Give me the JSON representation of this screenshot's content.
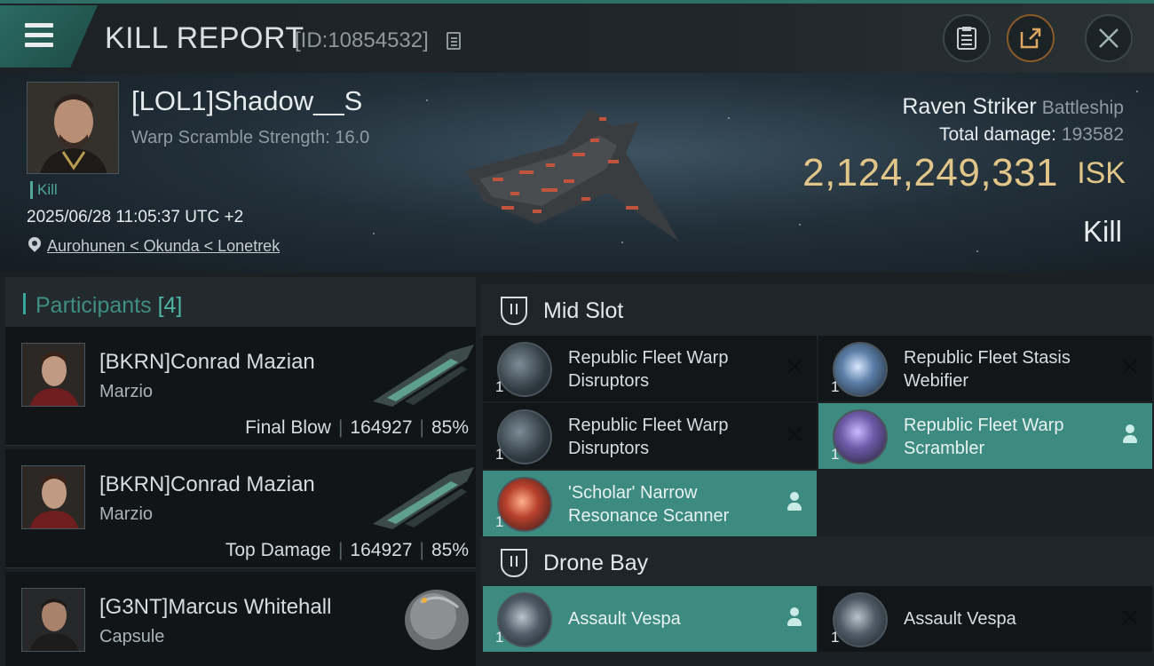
{
  "header": {
    "title": "KILL REPORT",
    "report_id": "[ID:10854532]"
  },
  "victim": {
    "name": "[LOL1]Shadow__S",
    "warp_strength": "Warp Scramble Strength: 16.0",
    "kill_tag": "Kill",
    "timestamp": "2025/06/28 11:05:37 UTC +2",
    "location": "Aurohunen < Okunda < Lonetrek",
    "ship_name": "Raven Striker",
    "ship_class": "Battleship",
    "total_damage_label": "Total damage:",
    "total_damage": "193582",
    "isk_value": "2,124,249,331",
    "isk_unit": "ISK",
    "result": "Kill"
  },
  "participants": {
    "label": "Participants",
    "count": "[4]",
    "items": [
      {
        "name": "[BKRN]Conrad Mazian",
        "ship": "Marzio",
        "role": "Final Blow",
        "damage": "164927",
        "percent": "85%"
      },
      {
        "name": "[BKRN]Conrad Mazian",
        "ship": "Marzio",
        "role": "Top Damage",
        "damage": "164927",
        "percent": "85%"
      },
      {
        "name": "[G3NT]Marcus Whitehall",
        "ship": "Capsule"
      }
    ]
  },
  "mid_slot": {
    "label": "Mid Slot",
    "items": [
      {
        "name": "Republic Fleet Warp Disruptors",
        "qty": "1",
        "status": "destroyed"
      },
      {
        "name": "Republic Fleet Stasis Webifier",
        "qty": "1",
        "status": "destroyed"
      },
      {
        "name": "Republic Fleet Warp Disruptors",
        "qty": "1",
        "status": "destroyed"
      },
      {
        "name": "Republic Fleet Warp Scrambler",
        "qty": "1",
        "status": "dropped"
      },
      {
        "name": "'Scholar' Narrow Resonance Scanner",
        "qty": "1",
        "status": "dropped"
      }
    ]
  },
  "drone_bay": {
    "label": "Drone Bay",
    "items": [
      {
        "name": "Assault Vespa",
        "qty": "1",
        "status": "dropped"
      },
      {
        "name": "Assault Vespa",
        "qty": "1",
        "status": "destroyed"
      }
    ]
  },
  "icons": {
    "menu": "menu-icon",
    "copy": "copy-icon",
    "clipboard": "clipboard-icon",
    "share": "share-icon",
    "close": "close-icon",
    "location": "location-pin-icon",
    "slot": "slot-shield-icon",
    "destroyed": "destroyed-x-icon",
    "dropped": "dropped-person-icon"
  },
  "colors": {
    "accent": "#3c8a80",
    "isk": "#e2c589",
    "kill_tag": "#4fa89a"
  }
}
